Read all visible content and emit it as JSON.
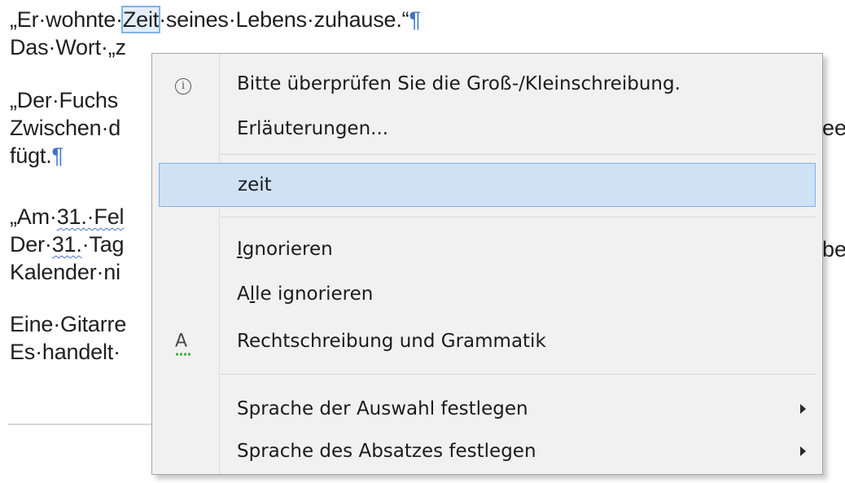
{
  "document": {
    "para1_before": "„Er·wohnte·",
    "para1_word": "Zeit",
    "para1_after": "·seines·Lebens·zuhause.“",
    "pilcrow": "¶",
    "para1_line2": "Das·Wort·„z",
    "para2_line1": "„Der·Fuchs",
    "para2_line2": "Zwischen·d",
    "para2_line2_right": "ee",
    "para2_line3": "fügt.",
    "para3_prefix": "„Am·",
    "para3_squig": "31.·Fel",
    "para3_line2_a": "Der·",
    "para3_line2_squig": "31.",
    "para3_line2_b": "·Tag",
    "para3_line2_right": "be",
    "para3_line3": "Kalender·ni",
    "para4_line1": "Eine·Gitarre",
    "para4_line2": "Es·handelt·"
  },
  "menu": {
    "items": [
      {
        "label": "Bitte überprüfen Sie die Groß-/Kleinschreibung.",
        "icon": "info-icon"
      },
      {
        "label": "Erläuterungen..."
      },
      {
        "label": "zeit",
        "selected": true
      },
      {
        "label_pre": "",
        "label_acc": "I",
        "label_post": "gnorieren"
      },
      {
        "label_pre": "A",
        "label_acc": "l",
        "label_post": "le ignorieren"
      },
      {
        "label": "Rechtschreibung und Grammatik",
        "icon": "spelling-grammar-icon"
      },
      {
        "label": "Sprache der Auswahl festlegen",
        "submenu": true
      },
      {
        "label": "Sprache des Absatzes festlegen",
        "submenu": true
      }
    ],
    "info_glyph": "i",
    "spell_glyph": "A"
  }
}
